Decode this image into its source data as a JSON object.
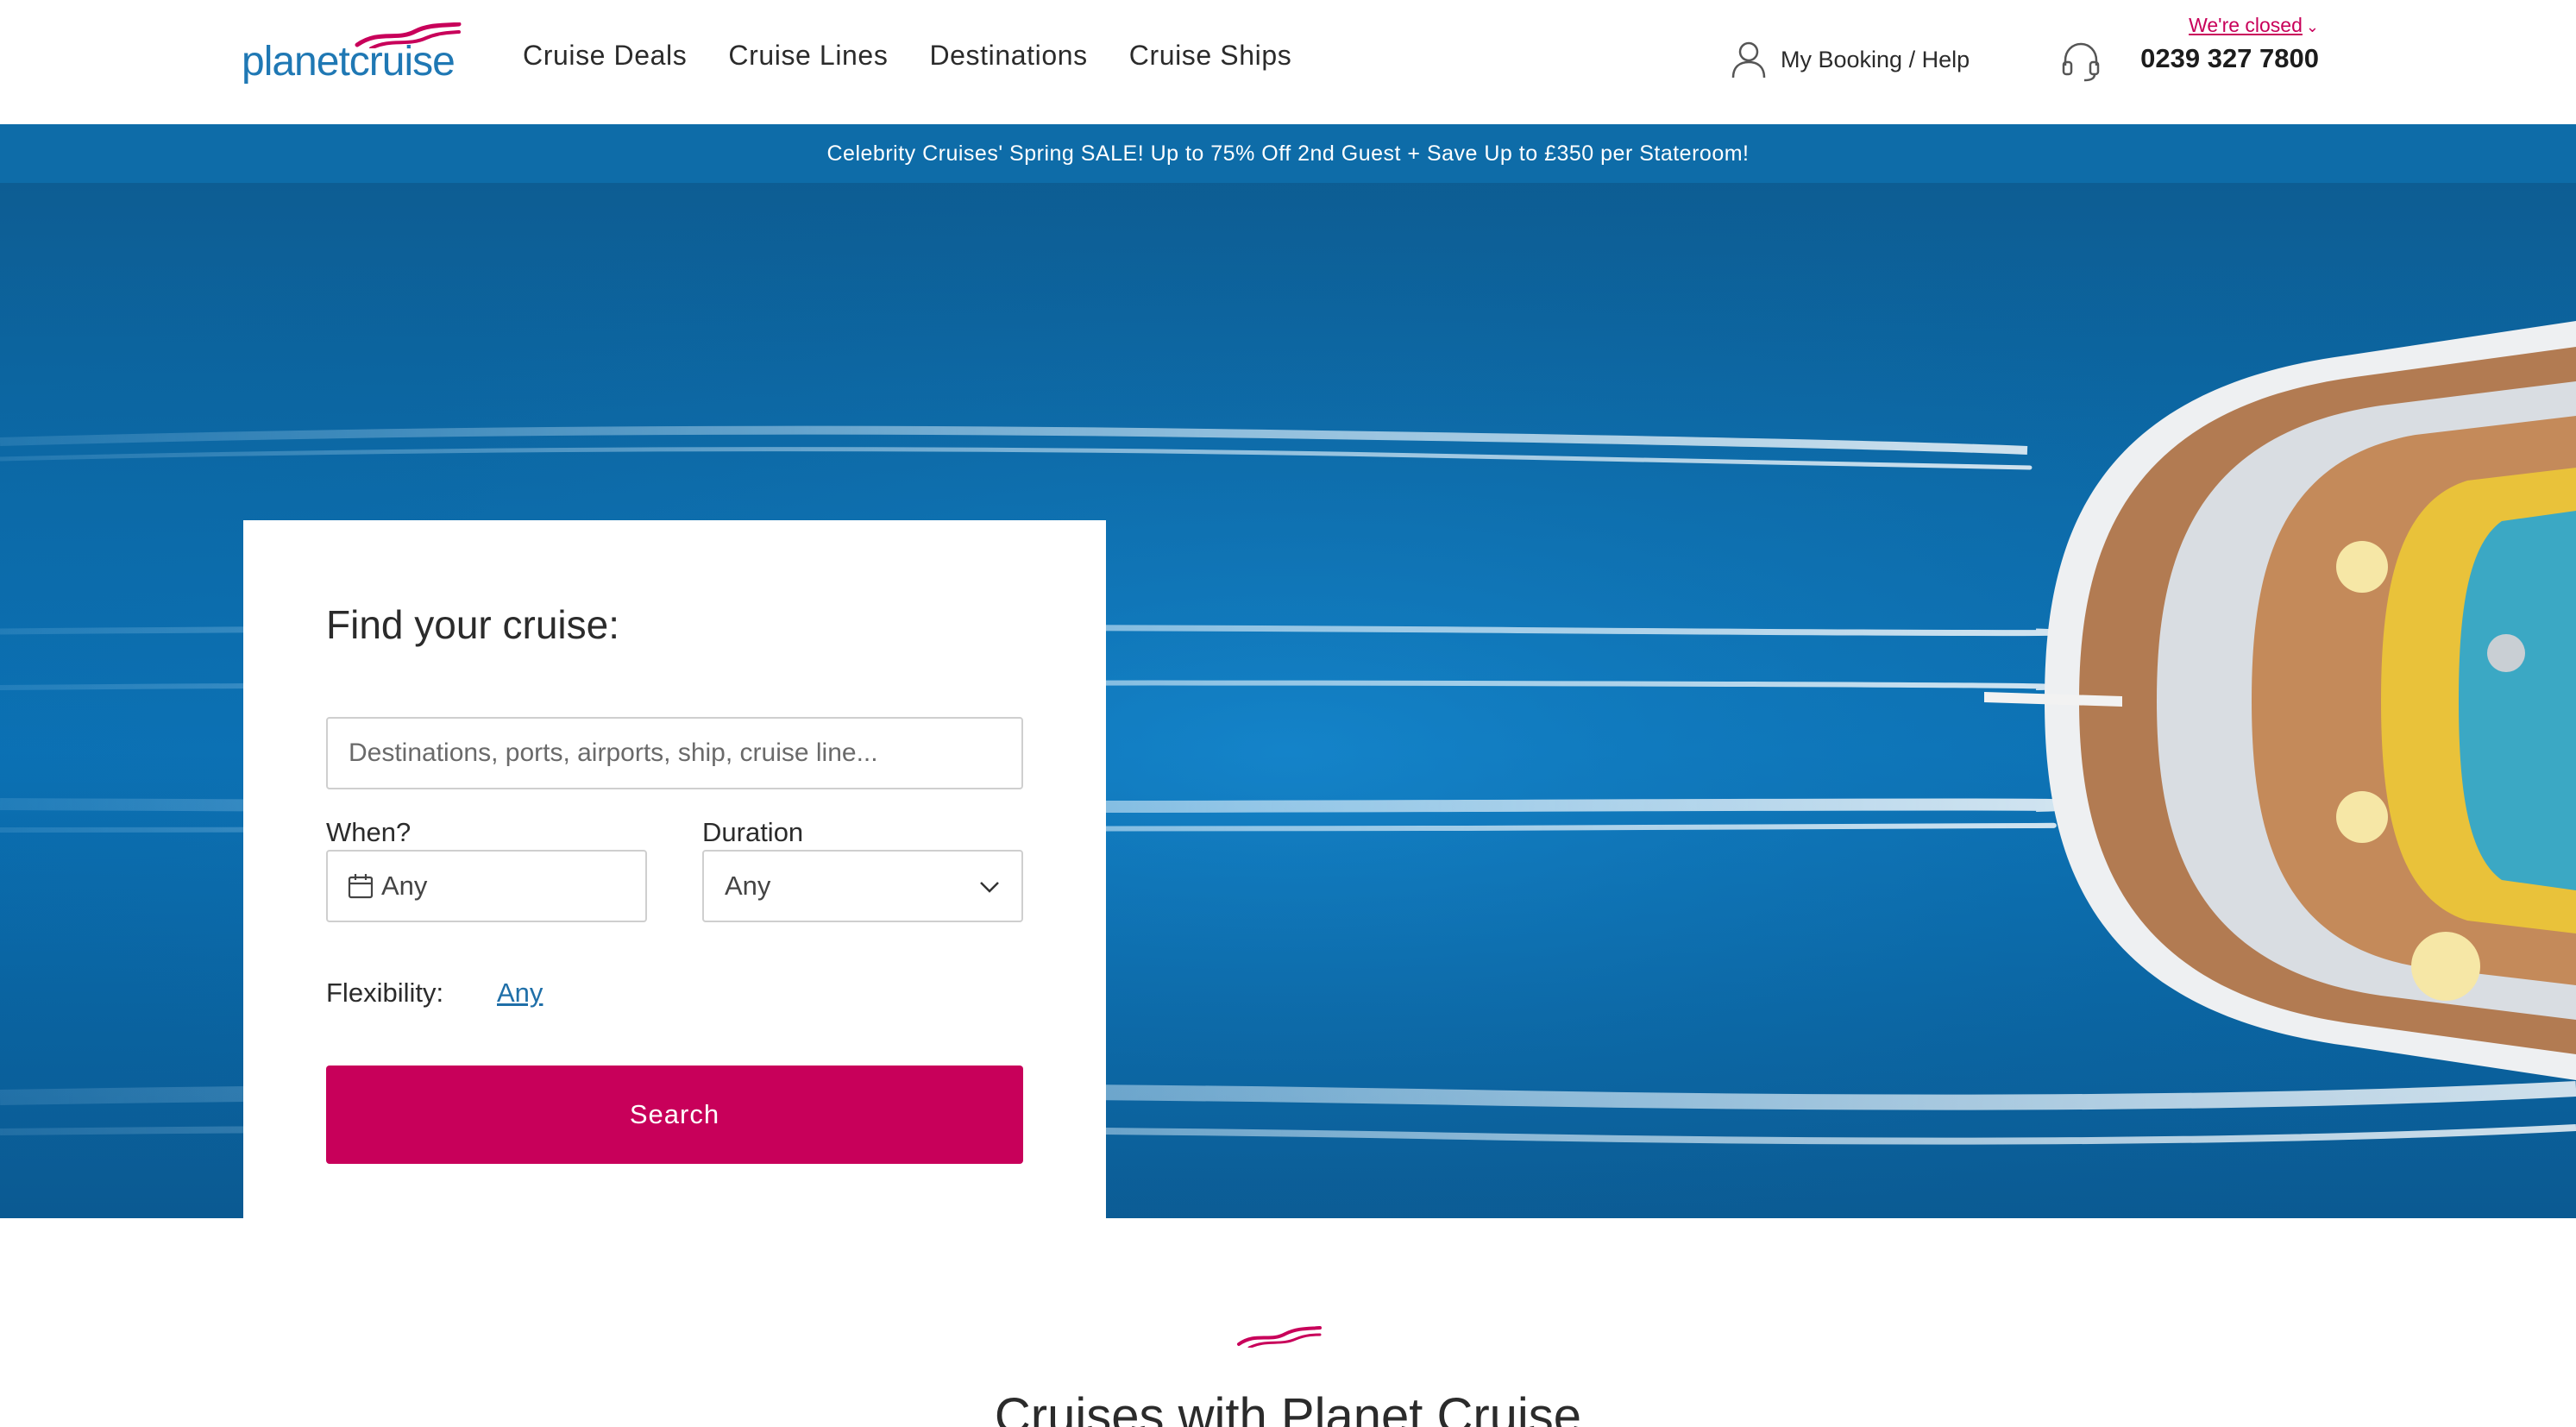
{
  "brand": {
    "logo_planet": "planet",
    "logo_cruise": "cruise",
    "wave_color": "#c8005a",
    "primary_color": "#1f78b4",
    "accent_color": "#c8005a"
  },
  "nav": {
    "items": [
      {
        "label": "Cruise Deals"
      },
      {
        "label": "Cruise Lines"
      },
      {
        "label": "Destinations"
      },
      {
        "label": "Cruise Ships"
      }
    ]
  },
  "header": {
    "account_label": "My Booking / Help",
    "account_icon": "user-icon",
    "closed_label": "We're closed",
    "phone_icon": "headset-icon",
    "phone_number": "0239 327 7800"
  },
  "promo": {
    "text": "Celebrity Cruises' Spring SALE! Up to 75% Off 2nd Guest + Save Up to £350 per Stateroom!",
    "background": "#0e6ca8"
  },
  "search": {
    "title": "Find your cruise:",
    "destination_placeholder": "Destinations, ports, airports, ship, cruise line...",
    "destination_value": "",
    "when_label": "When?",
    "when_value": "Any",
    "duration_label": "Duration",
    "duration_value": "Any",
    "flexibility_label": "Flexibility:",
    "flexibility_value": "Any",
    "search_button": "Search"
  },
  "section": {
    "title": "Cruises with Planet Cruise"
  }
}
